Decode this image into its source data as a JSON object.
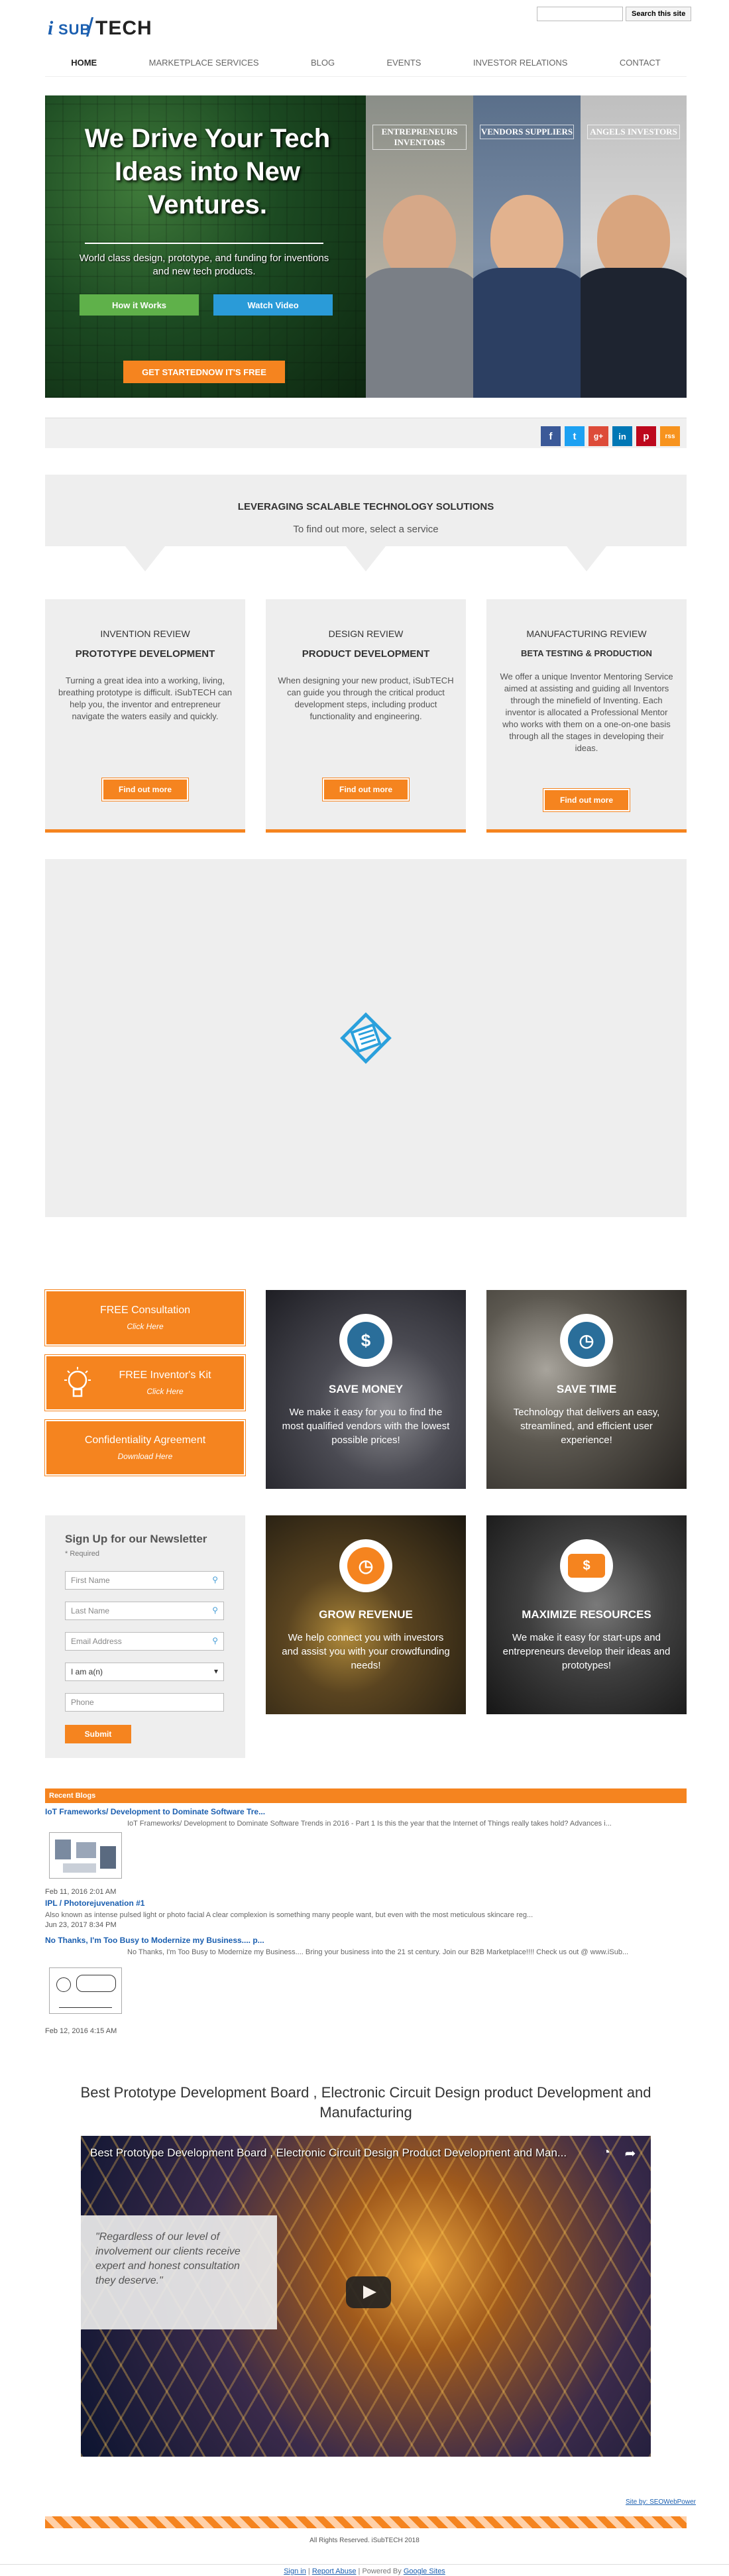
{
  "logo": {
    "i": "i",
    "sub": "SUB",
    "tech": "TECH"
  },
  "search": {
    "placeholder": "",
    "button": "Search this site"
  },
  "nav": [
    "HOME",
    "MARKETPLACE SERVICES",
    "BLOG",
    "EVENTS",
    "INVESTOR RELATIONS",
    "CONTACT"
  ],
  "hero": {
    "headline": "We Drive Your Tech Ideas into New Ventures.",
    "tagline": "World class design, prototype, and funding for inventions and new tech products.",
    "how_button": "How it Works",
    "video_button": "Watch Video",
    "cta_button": "GET STARTEDNOW IT'S FREE",
    "panels": [
      "ENTREPRENEURS INVENTORS",
      "VENDORS SUPPLIERS",
      "ANGELS INVESTORS"
    ]
  },
  "social": [
    "f",
    "t",
    "g+",
    "in",
    "p",
    "rss"
  ],
  "services": {
    "heading": "LEVERAGING SCALABLE TECHNOLOGY SOLUTIONS",
    "subheading": "To find out more, select a service",
    "cards": [
      {
        "title": "INVENTION REVIEW",
        "subtitle": "PROTOTYPE DEVELOPMENT",
        "desc": "Turning a great idea into a working, living, breathing prototype is difficult. iSubTECH can help you, the inventor and entrepreneur navigate the waters easily and quickly.",
        "button": "Find out more"
      },
      {
        "title": "DESIGN REVIEW",
        "subtitle": "PRODUCT DEVELOPMENT",
        "desc": "When designing your new product, iSubTECH can guide you through the critical product development steps, including product functionality and engineering.",
        "button": "Find out more"
      },
      {
        "title": "MANUFACTURING REVIEW",
        "subtitle": "BETA TESTING & PRODUCTION",
        "desc": "We offer a unique Inventor Mentoring Service aimed at assisting and guiding all Inventors through the minefield of Inventing. Each inventor is allocated a Professional Mentor who works with them on a one-on-one basis through all the stages in developing their ideas.",
        "button": "Find out more"
      }
    ]
  },
  "offers": [
    {
      "title": "FREE Consultation",
      "sub": "Click Here"
    },
    {
      "title": "FREE Inventor's Kit",
      "sub": "Click Here"
    },
    {
      "title": "Confidentiality Agreement",
      "sub": "Download Here"
    }
  ],
  "features": [
    {
      "title": "SAVE MONEY",
      "desc": "We make it easy for you to find the most qualified vendors with the lowest possible prices!",
      "icon": "money-hand-icon",
      "color": "#2a6e9a"
    },
    {
      "title": "SAVE TIME",
      "desc": "Technology that delivers an easy, streamlined, and efficient user experience!",
      "icon": "clock-icon",
      "color": "#2a6e9a"
    },
    {
      "title": "GROW REVENUE",
      "desc": "We help connect you with investors and assist you with your crowdfunding needs!",
      "icon": "clock-icon",
      "color": "#f5841f"
    },
    {
      "title": "MAXIMIZE RESOURCES",
      "desc": "We make it easy for start-ups and entrepreneurs develop their ideas and prototypes!",
      "icon": "dollar-bill-icon",
      "color": "#f5841f"
    }
  ],
  "newsletter": {
    "title": "Sign Up for our Newsletter",
    "required": "* Required",
    "first": "First Name",
    "last": "Last Name",
    "email": "Email Address",
    "role": "I am a(n)",
    "phone": "Phone",
    "submit": "Submit"
  },
  "blogs": {
    "header": "Recent Blogs",
    "posts": [
      {
        "title": "IoT Frameworks/ Development to Dominate Software Tre...",
        "excerpt": "IoT Frameworks/ Development to Dominate Software Trends in 2016 - Part 1 Is this the year that the Internet of Things really takes hold? Advances i...",
        "date": "Feb 11, 2016 2:01 AM"
      },
      {
        "title": "IPL / Photorejuvenation #1",
        "excerpt": "Also known as intense pulsed light or photo facial A clear complexion is something many people want, but even with the most meticulous skincare reg...",
        "date": "Jun 23, 2017 8:34 PM"
      },
      {
        "title": "No Thanks, I'm Too Busy to Modernize my Business.... p...",
        "excerpt": "No Thanks, I'm Too Busy to Modernize my Business.... Bring your business into the 21 st century. Join our B2B Marketplace!!!! Check us out @ www.iSub...",
        "date": "Feb 12, 2016 4:15 AM"
      }
    ]
  },
  "video": {
    "heading": "Best Prototype Development Board , Electronic Circuit Design product Development and Manufacturing",
    "title": "Best Prototype Development Board , Electronic Circuit Design Product Development and Man...",
    "quote": "\"Regardless of our level of involvement our clients receive expert and honest consultation they deserve.\""
  },
  "footer": {
    "site_by": "Site by: SEOWebPower",
    "copyright": "All Rights Reserved. iSubTECH 2018",
    "signin": "Sign in",
    "report": "Report Abuse",
    "powered": "Powered By",
    "google": "Google Sites"
  }
}
